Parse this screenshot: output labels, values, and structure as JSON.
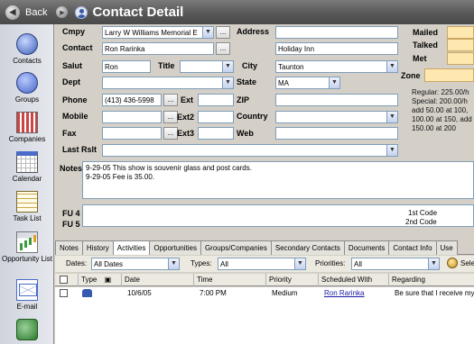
{
  "titlebar": {
    "back_label": "Back",
    "title": "Contact Detail"
  },
  "nav": [
    {
      "label": "Contacts",
      "icon": "contacts-icon"
    },
    {
      "label": "Groups",
      "icon": "groups-icon"
    },
    {
      "label": "Companies",
      "icon": "companies-icon"
    },
    {
      "label": "Calendar",
      "icon": "calendar-icon"
    },
    {
      "label": "Task List",
      "icon": "tasklist-icon"
    },
    {
      "label": "Opportunity List",
      "icon": "opportunity-icon"
    },
    {
      "label": "E-mail",
      "icon": "email-icon"
    },
    {
      "label": "",
      "icon": "web-icon"
    }
  ],
  "form": {
    "company_label": "Cmpy",
    "company_value": "Larry W Williams Memorial E",
    "contact_label": "Contact",
    "contact_value": "Ron Rarinka",
    "salut_label": "Salut",
    "salut_value": "Ron",
    "title_label": "Title",
    "title_value": "",
    "dept_label": "Dept",
    "dept_value": "",
    "phone_label": "Phone",
    "phone_value": "(413) 436-5998",
    "ext_label": "Ext",
    "ext_value": "",
    "mobile_label": "Mobile",
    "mobile_value": "",
    "ext2_label": "Ext2",
    "ext2_value": "",
    "fax_label": "Fax",
    "fax_value": "",
    "ext3_label": "Ext3",
    "ext3_value": "",
    "last_rslt_label": "Last Rslt",
    "last_rslt_value": "",
    "address_label": "Address",
    "address_line1": "",
    "address_line2": "Holiday Inn",
    "city_label": "City",
    "city_value": "Taunton",
    "state_label": "State",
    "state_value": "MA",
    "zip_label": "ZIP",
    "zip_value": "",
    "country_label": "Country",
    "country_value": "",
    "web_label": "Web",
    "web_value": "",
    "mailed_label": "Mailed",
    "talked_label": "Talked",
    "met_label": "Met",
    "zone_label": "Zone",
    "info_lines": [
      "Regular: 225.00/h",
      "Special: 200.00/h",
      "add 50.00 at 100,",
      "100.00 at 150, add",
      "150.00 at 200"
    ],
    "notes_label": "Notes",
    "notes_lines": [
      "9-29-05 This show is souvenir glass and post cards.",
      "9-29-05 Fee is 35.00."
    ],
    "fu4_label": "FU 4",
    "fu5_label": "FU 5",
    "first_code_label": "1st Code",
    "second_code_label": "2nd Code"
  },
  "tabs": [
    "Notes",
    "History",
    "Activities",
    "Opportunities",
    "Groups/Companies",
    "Secondary Contacts",
    "Documents",
    "Contact Info",
    "Use"
  ],
  "active_tab": "Activities",
  "filters": {
    "dates_label": "Dates:",
    "dates_value": "All Dates",
    "types_label": "Types:",
    "types_value": "All",
    "priorities_label": "Priorities:",
    "priorities_value": "All",
    "select_label": "Sele"
  },
  "grid": {
    "columns": [
      "Type",
      "Date",
      "Time",
      "Priority",
      "Scheduled With",
      "Regarding"
    ],
    "rows": [
      {
        "date": "10/6/05",
        "time": "7:00 PM",
        "priority": "Medium",
        "scheduled_with": "Ron Rarinka",
        "regarding": "Be sure that I receive my"
      }
    ]
  }
}
